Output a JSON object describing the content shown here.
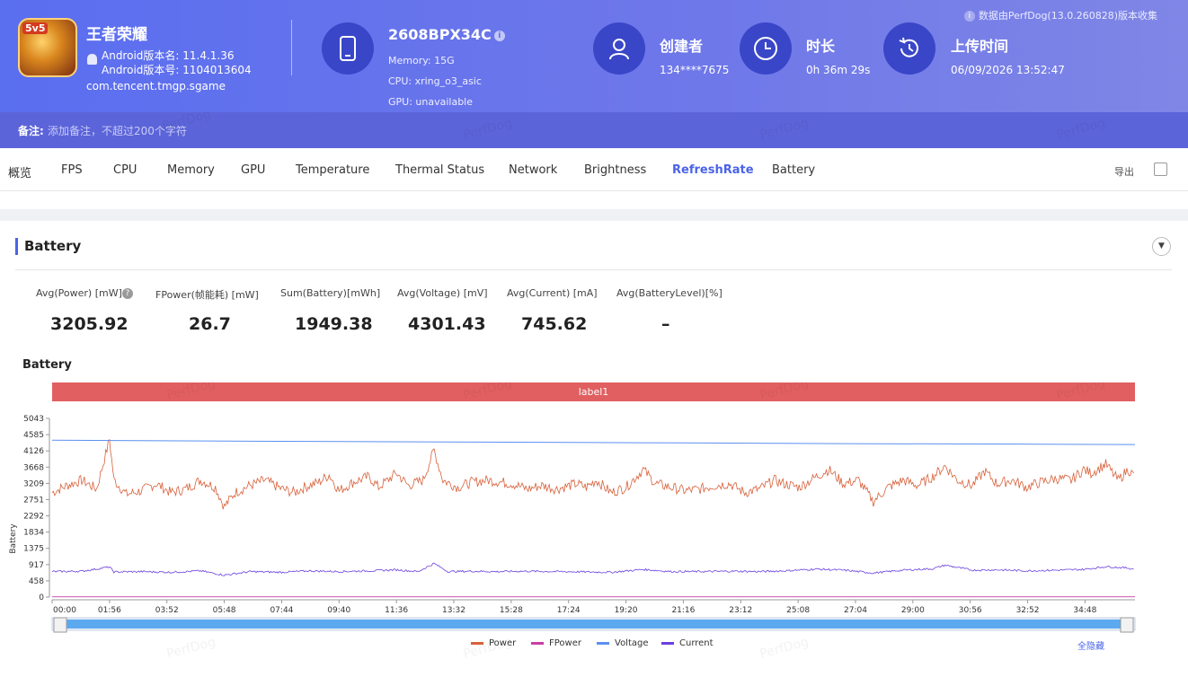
{
  "app": {
    "name": "王者荣耀",
    "icon_badge": "5v5",
    "version_name": "Android版本名: 11.4.1.36",
    "version_code": "Android版本号: 1104013604",
    "package": "com.tencent.tmgp.sgame"
  },
  "device": {
    "name": "2608BPX34C",
    "memory": "Memory: 15G",
    "cpu": "CPU: xring_o3_asic",
    "gpu": "GPU: unavailable"
  },
  "creator": {
    "title": "创建者",
    "value": "134****7675"
  },
  "duration": {
    "title": "时长",
    "value": "0h 36m 29s"
  },
  "upload": {
    "title": "上传时间",
    "value": "06/09/2026 13:52:47"
  },
  "source_note": "数据由PerfDog(13.0.260828)版本收集",
  "note": {
    "label": "备注:",
    "placeholder": "添加备注，不超过200个字符"
  },
  "tabs": [
    "概览",
    "FPS",
    "CPU",
    "Memory",
    "GPU",
    "Temperature",
    "Thermal Status",
    "Network",
    "Brightness",
    "RefreshRate",
    "Battery"
  ],
  "active_tab": "RefreshRate",
  "export_label": "导出",
  "watermark": "PerfDog",
  "section": {
    "title": "Battery"
  },
  "metrics": [
    {
      "label": "Avg(Power) [mW]",
      "value": "3205.92"
    },
    {
      "label": "FPower(帧能耗) [mW]",
      "value": "26.7"
    },
    {
      "label": "Sum(Battery)[mWh]",
      "value": "1949.38"
    },
    {
      "label": "Avg(Voltage) [mV]",
      "value": "4301.43"
    },
    {
      "label": "Avg(Current) [mA]",
      "value": "745.62"
    },
    {
      "label": "Avg(BatteryLevel)[%]",
      "value": "–"
    }
  ],
  "chart_title": "Battery",
  "label_band": "label1",
  "hide_all": "全隐藏",
  "colors": {
    "accent": "#4a63e8",
    "power": "#d8603a",
    "fpower": "#c63fa6",
    "voltage": "#5b8ff0",
    "current": "#6b3fe0",
    "label": "#e15f60"
  },
  "chart_data": {
    "type": "line",
    "ylabel": "Battery",
    "yticks": [
      0,
      458,
      917,
      1375,
      1834,
      2292,
      2751,
      3209,
      3668,
      4126,
      4585,
      5043
    ],
    "ylim": [
      0,
      5043
    ],
    "xlim_seconds": [
      0,
      2189
    ],
    "xticks": [
      "00:00",
      "01:56",
      "03:52",
      "05:48",
      "07:44",
      "09:40",
      "11:36",
      "13:32",
      "15:28",
      "17:24",
      "19:20",
      "21:16",
      "23:12",
      "25:08",
      "27:04",
      "29:00",
      "30:56",
      "32:52",
      "34:48"
    ],
    "legend_position": "bottom",
    "series": [
      {
        "name": "Power",
        "points": [
          [
            0,
            2950
          ],
          [
            30,
            3150
          ],
          [
            60,
            3300
          ],
          [
            90,
            3050
          ],
          [
            116,
            4450
          ],
          [
            125,
            3300
          ],
          [
            150,
            2900
          ],
          [
            180,
            3000
          ],
          [
            210,
            3200
          ],
          [
            240,
            2950
          ],
          [
            270,
            3050
          ],
          [
            300,
            3300
          ],
          [
            330,
            3100
          ],
          [
            348,
            2550
          ],
          [
            370,
            2950
          ],
          [
            400,
            3150
          ],
          [
            430,
            3300
          ],
          [
            464,
            3050
          ],
          [
            490,
            2950
          ],
          [
            510,
            3100
          ],
          [
            540,
            3250
          ],
          [
            560,
            3450
          ],
          [
            580,
            3000
          ],
          [
            610,
            3250
          ],
          [
            640,
            3400
          ],
          [
            660,
            3100
          ],
          [
            696,
            3500
          ],
          [
            720,
            3150
          ],
          [
            750,
            3300
          ],
          [
            772,
            4150
          ],
          [
            790,
            3300
          ],
          [
            820,
            3100
          ],
          [
            850,
            3250
          ],
          [
            880,
            3300
          ],
          [
            930,
            3200
          ],
          [
            960,
            3050
          ],
          [
            990,
            3150
          ],
          [
            1020,
            3050
          ],
          [
            1060,
            3200
          ],
          [
            1080,
            3100
          ],
          [
            1100,
            3300
          ],
          [
            1130,
            2950
          ],
          [
            1160,
            3100
          ],
          [
            1195,
            3600
          ],
          [
            1220,
            3200
          ],
          [
            1250,
            3100
          ],
          [
            1280,
            3000
          ],
          [
            1310,
            3050
          ],
          [
            1340,
            3150
          ],
          [
            1370,
            3200
          ],
          [
            1400,
            2950
          ],
          [
            1430,
            3050
          ],
          [
            1460,
            3300
          ],
          [
            1480,
            3200
          ],
          [
            1510,
            3100
          ],
          [
            1545,
            3400
          ],
          [
            1570,
            3600
          ],
          [
            1600,
            3200
          ],
          [
            1630,
            3300
          ],
          [
            1660,
            2700
          ],
          [
            1690,
            3100
          ],
          [
            1720,
            3300
          ],
          [
            1750,
            3150
          ],
          [
            1780,
            3400
          ],
          [
            1805,
            3700
          ],
          [
            1830,
            3300
          ],
          [
            1860,
            3150
          ],
          [
            1885,
            3550
          ],
          [
            1910,
            3200
          ],
          [
            1940,
            3300
          ],
          [
            1970,
            3100
          ],
          [
            2000,
            3250
          ],
          [
            2030,
            3350
          ],
          [
            2060,
            3300
          ],
          [
            2085,
            3600
          ],
          [
            2100,
            3500
          ],
          [
            2130,
            3750
          ],
          [
            2155,
            3300
          ],
          [
            2175,
            3600
          ],
          [
            2189,
            3400
          ]
        ]
      },
      {
        "name": "FPower",
        "points": [
          [
            0,
            8
          ],
          [
            2189,
            8
          ]
        ]
      },
      {
        "name": "Voltage",
        "points": [
          [
            0,
            4430
          ],
          [
            400,
            4400
          ],
          [
            800,
            4380
          ],
          [
            1200,
            4355
          ],
          [
            1600,
            4330
          ],
          [
            2000,
            4315
          ],
          [
            2189,
            4305
          ]
        ]
      },
      {
        "name": "Current",
        "points": [
          [
            0,
            720
          ],
          [
            60,
            730
          ],
          [
            116,
            850
          ],
          [
            125,
            710
          ],
          [
            180,
            720
          ],
          [
            240,
            700
          ],
          [
            300,
            740
          ],
          [
            348,
            620
          ],
          [
            400,
            720
          ],
          [
            464,
            700
          ],
          [
            520,
            740
          ],
          [
            580,
            720
          ],
          [
            640,
            740
          ],
          [
            696,
            770
          ],
          [
            740,
            720
          ],
          [
            772,
            950
          ],
          [
            800,
            720
          ],
          [
            850,
            730
          ],
          [
            900,
            720
          ],
          [
            960,
            730
          ],
          [
            1020,
            720
          ],
          [
            1080,
            710
          ],
          [
            1130,
            700
          ],
          [
            1195,
            780
          ],
          [
            1250,
            720
          ],
          [
            1310,
            720
          ],
          [
            1380,
            730
          ],
          [
            1430,
            720
          ],
          [
            1480,
            740
          ],
          [
            1545,
            790
          ],
          [
            1600,
            760
          ],
          [
            1660,
            680
          ],
          [
            1720,
            760
          ],
          [
            1780,
            800
          ],
          [
            1805,
            900
          ],
          [
            1860,
            760
          ],
          [
            1910,
            770
          ],
          [
            1970,
            740
          ],
          [
            2030,
            760
          ],
          [
            2085,
            780
          ],
          [
            2130,
            860
          ],
          [
            2175,
            820
          ],
          [
            2189,
            780
          ]
        ]
      }
    ],
    "slider_range": [
      0,
      2189
    ]
  }
}
